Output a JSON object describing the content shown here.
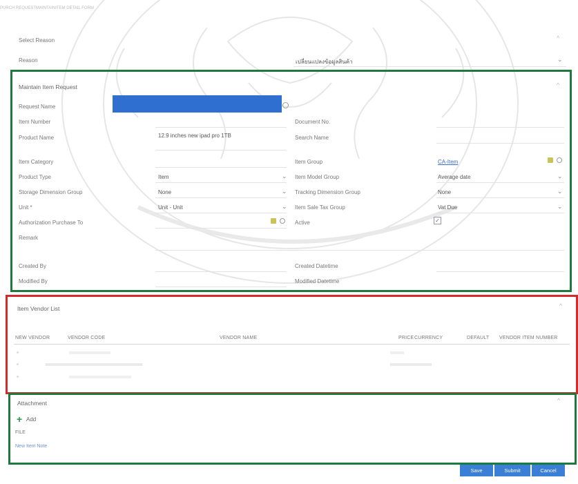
{
  "form_title": "PURCH REQUESTMAINTAINITEM DETAIL FORM",
  "select_reason": {
    "section_label": "Select Reason",
    "reason_label": "Reason",
    "reason_value": "เปลี่ยนแปลงข้อมูลสินค้า"
  },
  "maintain": {
    "title": "Maintain Item Request",
    "request_name_label": "Request Name",
    "item_number_label": "Item Number",
    "document_no_label": "Document No.",
    "product_name_label": "Product Name",
    "product_name_value": "12.9 inches new ipad pro 1TB",
    "search_name_label": "Search Name",
    "item_category_label": "Item Category",
    "item_group_label": "Item Group",
    "item_group_value": "CA-Item",
    "product_type_label": "Product Type",
    "product_type_value": "Item",
    "item_model_group_label": "Item Model Group",
    "item_model_group_value": "Average date",
    "storage_dimension_label": "Storage Dimension Group",
    "storage_dimension_value": "None",
    "tracking_dimension_label": "Tracking Dimension Group",
    "tracking_dimension_value": "None",
    "unit_label": "Unit *",
    "unit_value": "Unit - Unit",
    "item_sale_tax_label": "Item Sale Tax Group",
    "item_sale_tax_value": "Vat Due",
    "authorization_label": "Authorization Purchase To",
    "active_label": "Active",
    "remark_label": "Remark",
    "created_by_label": "Created By",
    "created_datetime_label": "Created Datetime",
    "modified_by_label": "Modified By",
    "modified_datetime_label": "Modified Datetime"
  },
  "vendor": {
    "title": "Item Vendor List",
    "columns": {
      "new_vendor": "NEW VENDOR",
      "vendor_code": "VENDOR CODE",
      "vendor_name": "VENDOR NAME",
      "price": "PRICE",
      "currency": "CURRENCY",
      "default": "DEFAULT",
      "vendor_item_number": "VENDOR ITEM NUMBER"
    }
  },
  "attachment": {
    "title": "Attachment",
    "add_label": "Add",
    "file_label": "FILE",
    "link_label": "New Item Note"
  },
  "buttons": {
    "save": "Save",
    "submit": "Submit",
    "cancel": "Cancel"
  },
  "colors": {
    "green_box": "#1e7a3c",
    "red_box": "#d42a2a",
    "redaction": "#2f6fd0",
    "button": "#3a7fd5"
  }
}
